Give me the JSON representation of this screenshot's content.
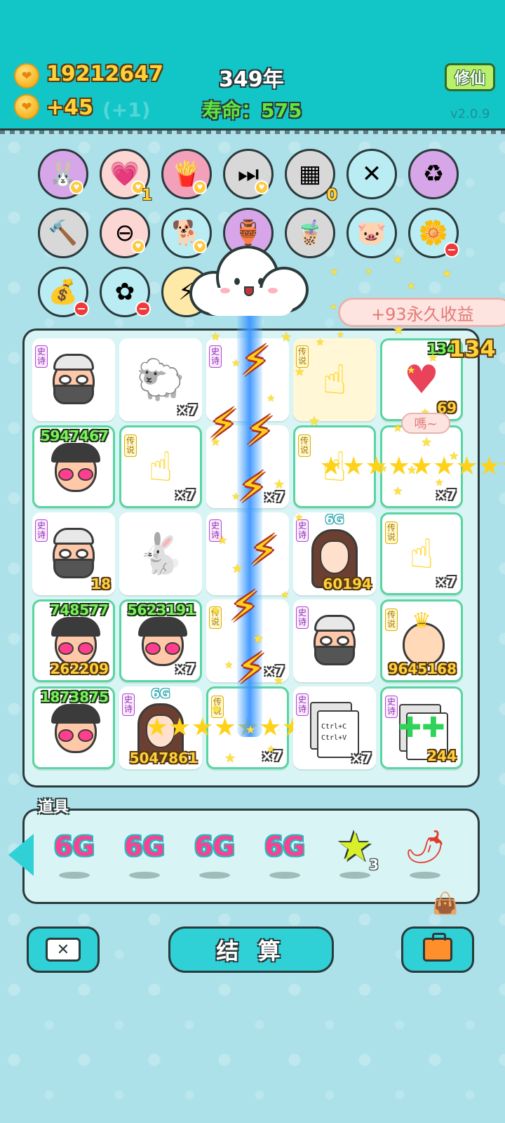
{
  "header": {
    "coins": "19212647",
    "coins_rate": "+45",
    "coins_rate_faded": "(+1)",
    "year": "349年",
    "lifespan_label": "寿命：575",
    "cultivate_button": "修仙",
    "version": "v2.0.9"
  },
  "abilities": [
    {
      "name": "rabbit-icon",
      "bg": "#d7a6e8",
      "badge": "heart"
    },
    {
      "name": "heart-coin-icon",
      "bg": "#fbd6d3",
      "badge": "heart",
      "count": "1"
    },
    {
      "name": "fries-icon",
      "bg": "#f3a1bb",
      "badge": "heart"
    },
    {
      "name": "skip-icon",
      "bg": "#d8d8d8",
      "badge": "heart"
    },
    {
      "name": "egg-tray-icon",
      "bg": "#d8d8d8",
      "count": "0"
    },
    {
      "name": "sticks-icon",
      "bg": "#b9ecf3"
    },
    {
      "name": "recycle-icon",
      "bg": "#d7a6e8"
    },
    {
      "name": "hammer-icon",
      "bg": "#d8d8d8"
    },
    {
      "name": "no-entry-icon",
      "bg": "#fbd6d3",
      "badge": "heart"
    },
    {
      "name": "dog-icon",
      "bg": "#b9ecf3",
      "badge": "heart"
    },
    {
      "name": "jar-icon",
      "bg": "#d7a6e8"
    },
    {
      "name": "bubble-tea-icon",
      "bg": "#d8d8d8"
    },
    {
      "name": "piggy-bank-icon",
      "bg": "#b9ecf3"
    },
    {
      "name": "potted-flower-icon",
      "bg": "#b9ecf3",
      "badge": "minus"
    },
    {
      "name": "sack-icon",
      "bg": "#b9ecf3",
      "badge": "minus"
    },
    {
      "name": "star-flower-icon",
      "bg": "#b9ecf3",
      "badge": "minus"
    },
    {
      "name": "lightning-icon",
      "bg": "#ffe9a8"
    }
  ],
  "grid": {
    "tags": {
      "epic": "史诗",
      "legend": "传说"
    },
    "cells": [
      {
        "kind": "cap-beard",
        "tag": "epic"
      },
      {
        "kind": "sheep",
        "mult": "×7"
      },
      {
        "kind": "blank",
        "tag": "epic"
      },
      {
        "kind": "hand-gold",
        "tag": "legend"
      },
      {
        "kind": "heart-shield",
        "top": "134",
        "bot": "69"
      },
      {
        "kind": "hat-shades",
        "top": "5947467"
      },
      {
        "kind": "hand",
        "tag": "legend",
        "mult": "×7"
      },
      {
        "kind": "blank",
        "mult": "×7"
      },
      {
        "kind": "hand",
        "tag": "legend"
      },
      {
        "kind": "stars",
        "mult": "×7"
      },
      {
        "kind": "cap-beard",
        "tag": "epic",
        "bot": "18"
      },
      {
        "kind": "bunny"
      },
      {
        "kind": "blank",
        "tag": "epic"
      },
      {
        "kind": "girl",
        "tag": "epic",
        "six_g": "6G",
        "bot": "60194"
      },
      {
        "kind": "hand",
        "tag": "legend",
        "mult": "×7"
      },
      {
        "kind": "hat-shades",
        "top": "748577",
        "bot": "262209"
      },
      {
        "kind": "hat-shades",
        "top": "5623191",
        "mult": "×7"
      },
      {
        "kind": "blank",
        "tag": "legend",
        "mult": "×7"
      },
      {
        "kind": "cap-beard",
        "tag": "epic"
      },
      {
        "kind": "king",
        "tag": "legend",
        "bot": "9645168"
      },
      {
        "kind": "hat-shades",
        "top": "1873875"
      },
      {
        "kind": "girl",
        "tag": "epic",
        "six_g": "6G",
        "bot": "5047861"
      },
      {
        "kind": "stars",
        "tag": "legend",
        "mult": "×7"
      },
      {
        "kind": "ctrl",
        "tag": "epic",
        "mult": "×7",
        "c1": "Ctrl+C",
        "c2": "Ctrl+V"
      },
      {
        "kind": "ctrl-green",
        "tag": "epic",
        "bot": "244"
      }
    ]
  },
  "effects": {
    "income_bubble": "+93永久收益",
    "side_number": "134",
    "bubble_small": "嗎~"
  },
  "items": {
    "label": "道具",
    "list": [
      {
        "type": "6g",
        "text": "6G"
      },
      {
        "type": "6g",
        "text": "6G"
      },
      {
        "type": "6g",
        "text": "6G"
      },
      {
        "type": "6g",
        "text": "6G"
      },
      {
        "type": "star",
        "qty": "3"
      },
      {
        "type": "pepper"
      }
    ]
  },
  "buttons": {
    "settle": "结 算"
  }
}
